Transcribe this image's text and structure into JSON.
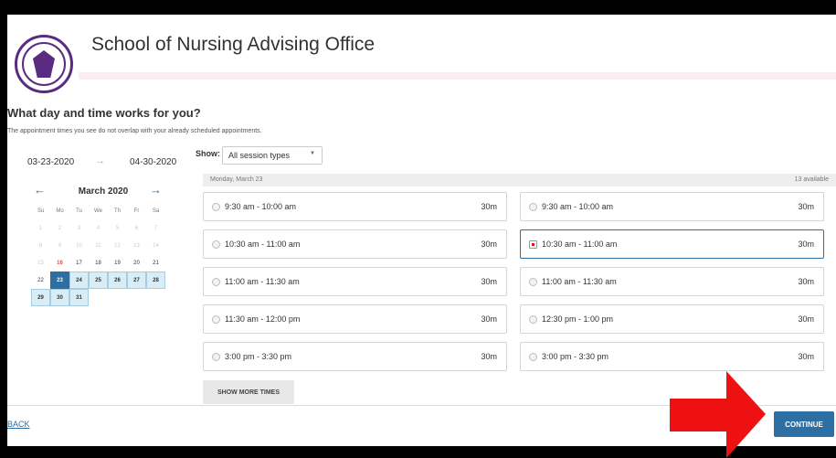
{
  "header": {
    "title": "School of Nursing Advising Office"
  },
  "prompt": {
    "question": "What day and time works for you?",
    "note": "The appointment times you see do not overlap with your already scheduled appointments."
  },
  "range": {
    "start": "03-23-2020",
    "arrow": "→",
    "end": "04-30-2020"
  },
  "calendar": {
    "month": "March 2020",
    "prev": "←",
    "next": "→",
    "dow": [
      "Su",
      "Mo",
      "Tu",
      "We",
      "Th",
      "Fr",
      "Sa"
    ],
    "days": [
      {
        "d": "1",
        "s": "past"
      },
      {
        "d": "2",
        "s": "past"
      },
      {
        "d": "3",
        "s": "past"
      },
      {
        "d": "4",
        "s": "past"
      },
      {
        "d": "5",
        "s": "past"
      },
      {
        "d": "6",
        "s": "past"
      },
      {
        "d": "7",
        "s": "past"
      },
      {
        "d": "8",
        "s": "past"
      },
      {
        "d": "9",
        "s": "past"
      },
      {
        "d": "10",
        "s": "past"
      },
      {
        "d": "11",
        "s": "past"
      },
      {
        "d": "12",
        "s": "past"
      },
      {
        "d": "13",
        "s": "past"
      },
      {
        "d": "14",
        "s": "past"
      },
      {
        "d": "15",
        "s": "dim"
      },
      {
        "d": "16",
        "s": "today"
      },
      {
        "d": "17",
        "s": "plain"
      },
      {
        "d": "18",
        "s": "plain"
      },
      {
        "d": "19",
        "s": "plain"
      },
      {
        "d": "20",
        "s": "plain"
      },
      {
        "d": "21",
        "s": "plain"
      },
      {
        "d": "22",
        "s": "plain"
      },
      {
        "d": "23",
        "s": "sel"
      },
      {
        "d": "24",
        "s": "avail"
      },
      {
        "d": "25",
        "s": "avail"
      },
      {
        "d": "26",
        "s": "avail"
      },
      {
        "d": "27",
        "s": "avail"
      },
      {
        "d": "28",
        "s": "avail"
      },
      {
        "d": "29",
        "s": "avail"
      },
      {
        "d": "30",
        "s": "avail"
      },
      {
        "d": "31",
        "s": "avail"
      }
    ]
  },
  "filter": {
    "label": "Show:",
    "value": "All session types",
    "caret": "▼"
  },
  "day": {
    "date": "Monday, March 23",
    "available": "13 available"
  },
  "slots": [
    {
      "time": "9:30 am - 10:00 am",
      "dur": "30m"
    },
    {
      "time": "9:30 am - 10:00 am",
      "dur": "30m"
    },
    {
      "time": "10:30 am - 11:00 am",
      "dur": "30m"
    },
    {
      "time": "10:30 am - 11:00 am",
      "dur": "30m"
    },
    {
      "time": "11:00 am - 11:30 am",
      "dur": "30m"
    },
    {
      "time": "11:00 am - 11:30 am",
      "dur": "30m"
    },
    {
      "time": "11:30 am - 12:00 pm",
      "dur": "30m"
    },
    {
      "time": "12:30 pm - 1:00 pm",
      "dur": "30m"
    },
    {
      "time": "3:00 pm - 3:30 pm",
      "dur": "30m"
    },
    {
      "time": "3:00 pm - 3:30 pm",
      "dur": "30m"
    }
  ],
  "actions": {
    "more": "SHOW MORE TIMES",
    "back": "BACK",
    "continue": "CONTINUE"
  },
  "colors": {
    "accent": "#2d6ea3",
    "annotation": "#ee1111",
    "brand": "#5b2b82"
  }
}
